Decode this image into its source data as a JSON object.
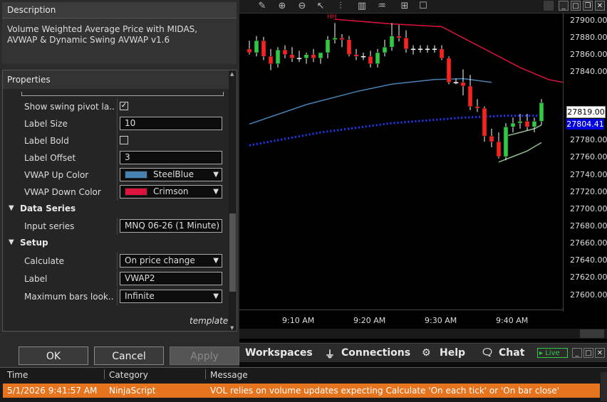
{
  "description": {
    "header": "Description",
    "text": "Volume Weighted Average Price with MIDAS, AVWAP & Dynamic Swing AVWAP v1.6"
  },
  "properties": {
    "header": "Properties",
    "rows": [
      {
        "label": "Show swing pivot la...",
        "type": "check",
        "checked": true
      },
      {
        "label": "Label Size",
        "type": "text",
        "value": "10"
      },
      {
        "label": "Label Bold",
        "type": "check",
        "checked": false
      },
      {
        "label": "Label Offset",
        "type": "text",
        "value": "3"
      },
      {
        "label": "VWAP Up Color",
        "type": "color",
        "value": "SteelBlue",
        "color": "#4682B4"
      },
      {
        "label": "VWAP Down Color",
        "type": "color",
        "value": "Crimson",
        "color": "#DC143C"
      }
    ],
    "data_series_category": "Data Series",
    "input_series_label": "Input series",
    "input_series_value": "MNQ 06-26 (1 Minute)",
    "setup_category": "Setup",
    "calculate_label": "Calculate",
    "calculate_value": "On price change",
    "label_label": "Label",
    "label_value": "VWAP2",
    "max_bars_label": "Maximum bars look...",
    "max_bars_value": "Infinite",
    "template_label": "template"
  },
  "buttons": {
    "ok": "OK",
    "cancel": "Cancel",
    "apply": "Apply"
  },
  "control_bar": {
    "workspaces": "Workspaces",
    "connections": "Connections",
    "help": "Help",
    "chat": "Chat",
    "live": "Live"
  },
  "log": {
    "headers": {
      "time": "Time",
      "category": "Category",
      "message": "Message"
    },
    "row": {
      "time": "5/1/2026 9:41:57 AM",
      "category": "NinjaScript",
      "message": "VOL relies on volume updates expecting Calculate 'On each tick' or 'On bar close'"
    }
  },
  "colors": {
    "highlight": "#E6731D",
    "up": "#4682B4",
    "down": "#DC143C"
  },
  "chart_data": {
    "type": "candlestick",
    "price_ticks": [
      "27900.00",
      "27880.00",
      "27860.00",
      "27840.00",
      "27780.00",
      "27760.00",
      "27740.00",
      "27720.00",
      "27700.00",
      "27680.00",
      "27660.00",
      "27640.00",
      "27620.00",
      "27600.00"
    ],
    "time_ticks": [
      "9:10 AM",
      "9:20 AM",
      "9:30 AM",
      "9:40 AM"
    ],
    "last_price_labels": [
      "27819.00",
      "27804.41"
    ],
    "swing_marker": "HH",
    "ylim": [
      27595,
      27915
    ],
    "candles": [
      {
        "o": 27876,
        "h": 27885,
        "l": 27870,
        "c": 27872
      },
      {
        "o": 27872,
        "h": 27890,
        "l": 27868,
        "c": 27885
      },
      {
        "o": 27885,
        "h": 27889,
        "l": 27864,
        "c": 27868
      },
      {
        "o": 27868,
        "h": 27876,
        "l": 27853,
        "c": 27860
      },
      {
        "o": 27860,
        "h": 27878,
        "l": 27856,
        "c": 27875
      },
      {
        "o": 27875,
        "h": 27880,
        "l": 27866,
        "c": 27870
      },
      {
        "o": 27870,
        "h": 27878,
        "l": 27862,
        "c": 27866
      },
      {
        "o": 27866,
        "h": 27874,
        "l": 27862,
        "c": 27866
      },
      {
        "o": 27866,
        "h": 27872,
        "l": 27860,
        "c": 27870
      },
      {
        "o": 27870,
        "h": 27876,
        "l": 27862,
        "c": 27866
      },
      {
        "o": 27866,
        "h": 27872,
        "l": 27860,
        "c": 27872
      },
      {
        "o": 27872,
        "h": 27890,
        "l": 27866,
        "c": 27886
      },
      {
        "o": 27886,
        "h": 27904,
        "l": 27882,
        "c": 27888
      },
      {
        "o": 27888,
        "h": 27892,
        "l": 27878,
        "c": 27886
      },
      {
        "o": 27886,
        "h": 27890,
        "l": 27868,
        "c": 27870
      },
      {
        "o": 27870,
        "h": 27876,
        "l": 27864,
        "c": 27868
      },
      {
        "o": 27868,
        "h": 27872,
        "l": 27864,
        "c": 27868
      },
      {
        "o": 27868,
        "h": 27874,
        "l": 27856,
        "c": 27860
      },
      {
        "o": 27860,
        "h": 27876,
        "l": 27856,
        "c": 27872
      },
      {
        "o": 27872,
        "h": 27886,
        "l": 27868,
        "c": 27878
      },
      {
        "o": 27878,
        "h": 27904,
        "l": 27874,
        "c": 27890
      },
      {
        "o": 27890,
        "h": 27902,
        "l": 27884,
        "c": 27888
      },
      {
        "o": 27888,
        "h": 27896,
        "l": 27872,
        "c": 27876
      },
      {
        "o": 27876,
        "h": 27880,
        "l": 27870,
        "c": 27876
      },
      {
        "o": 27876,
        "h": 27880,
        "l": 27872,
        "c": 27876
      },
      {
        "o": 27876,
        "h": 27880,
        "l": 27872,
        "c": 27876
      },
      {
        "o": 27876,
        "h": 27880,
        "l": 27872,
        "c": 27876
      },
      {
        "o": 27876,
        "h": 27880,
        "l": 27864,
        "c": 27866
      },
      {
        "o": 27866,
        "h": 27868,
        "l": 27838,
        "c": 27840
      },
      {
        "o": 27840,
        "h": 27844,
        "l": 27838,
        "c": 27840
      },
      {
        "o": 27840,
        "h": 27854,
        "l": 27826,
        "c": 27836
      },
      {
        "o": 27836,
        "h": 27848,
        "l": 27810,
        "c": 27814
      },
      {
        "o": 27814,
        "h": 27822,
        "l": 27808,
        "c": 27812
      },
      {
        "o": 27812,
        "h": 27814,
        "l": 27776,
        "c": 27782
      },
      {
        "o": 27782,
        "h": 27790,
        "l": 27770,
        "c": 27776
      },
      {
        "o": 27776,
        "h": 27786,
        "l": 27758,
        "c": 27760
      },
      {
        "o": 27760,
        "h": 27796,
        "l": 27756,
        "c": 27792
      },
      {
        "o": 27792,
        "h": 27802,
        "l": 27786,
        "c": 27796
      },
      {
        "o": 27796,
        "h": 27806,
        "l": 27790,
        "c": 27798
      },
      {
        "o": 27798,
        "h": 27806,
        "l": 27788,
        "c": 27792
      },
      {
        "o": 27792,
        "h": 27802,
        "l": 27786,
        "c": 27798
      },
      {
        "o": 27798,
        "h": 27822,
        "l": 27794,
        "c": 27818
      }
    ],
    "series": [
      {
        "color": "#DC143C",
        "style": "solid",
        "values": [
          [
            12,
            27908
          ],
          [
            20,
            27903
          ],
          [
            27,
            27900
          ],
          [
            30,
            27888
          ],
          [
            34,
            27872
          ],
          [
            38,
            27856
          ],
          [
            42,
            27843
          ],
          [
            44,
            27840
          ]
        ]
      },
      {
        "color": "#4682B4",
        "style": "solid",
        "values": [
          [
            0,
            27795
          ],
          [
            8,
            27816
          ],
          [
            15,
            27830
          ],
          [
            20,
            27838
          ],
          [
            26,
            27843
          ],
          [
            30,
            27844
          ],
          [
            34,
            27840
          ]
        ]
      },
      {
        "color": "#1E3CFF",
        "style": "dotted",
        "values": [
          [
            0,
            27772
          ],
          [
            10,
            27786
          ],
          [
            20,
            27796
          ],
          [
            30,
            27802
          ],
          [
            36,
            27804
          ],
          [
            41,
            27804
          ]
        ]
      },
      {
        "color": "#8FBC8F",
        "style": "solid",
        "values": [
          [
            35,
            27754
          ],
          [
            37,
            27760
          ],
          [
            39,
            27766
          ],
          [
            41,
            27775
          ]
        ]
      },
      {
        "color": "#8FBC8F",
        "style": "solid",
        "values": [
          [
            36,
            27782
          ],
          [
            38,
            27786
          ],
          [
            40,
            27790
          ],
          [
            41,
            27794
          ]
        ]
      }
    ]
  }
}
